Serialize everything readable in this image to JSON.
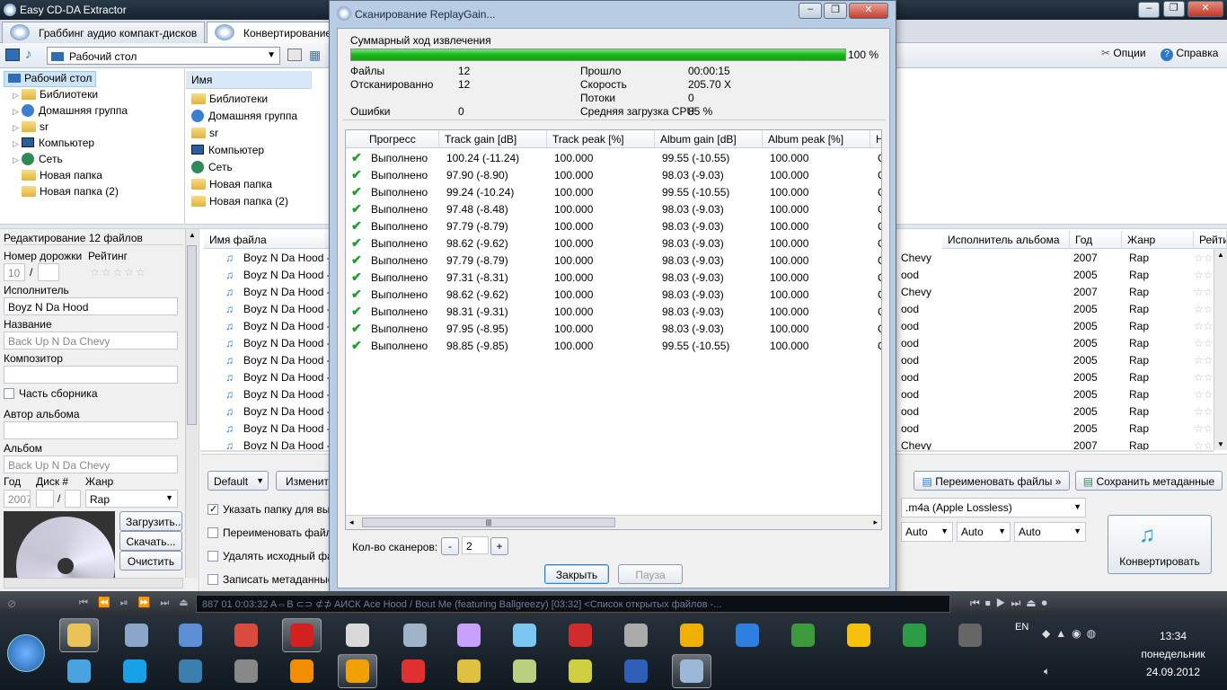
{
  "app": {
    "title": "Easy CD-DA Extractor",
    "tabs": [
      {
        "label": "Граббинг аудио компакт-дисков"
      },
      {
        "label": "Конвертирование"
      }
    ],
    "toolbar": {
      "location_combo": "Рабочий стол",
      "options_label": "Опции",
      "help_label": "Справка"
    }
  },
  "tree": {
    "root": "Рабочий стол",
    "items": [
      {
        "label": "Библиотеки"
      },
      {
        "label": "Домашняя группа"
      },
      {
        "label": "sr"
      },
      {
        "label": "Компьютер"
      },
      {
        "label": "Сеть"
      },
      {
        "label": "Новая папка"
      },
      {
        "label": "Новая папка (2)"
      }
    ]
  },
  "filelist": {
    "header": "Имя",
    "items": [
      {
        "label": "Библиотеки"
      },
      {
        "label": "Домашняя группа"
      },
      {
        "label": "sr"
      },
      {
        "label": "Компьютер"
      },
      {
        "label": "Сеть"
      },
      {
        "label": "Новая папка"
      },
      {
        "label": "Новая папка (2)"
      }
    ]
  },
  "editor": {
    "title": "Редактирование 12 файлов",
    "track_label": "Номер дорожки",
    "rating_label": "Рейтинг",
    "track_no": "10",
    "track_sep": "/",
    "artist_label": "Исполнитель",
    "artist": "Boyz N Da Hood",
    "title_label": "Название",
    "title_value": "Back Up N Da Chevy",
    "composer_label": "Композитор",
    "compilation_label": "Часть сборника",
    "album_artist_label": "Автор альбома",
    "album_label": "Альбом",
    "album_value": "Back Up N Da Chevy",
    "year_label": "Год",
    "disc_label": "Диск #",
    "genre_label": "Жанр",
    "year": "2007",
    "disc_sep": "/",
    "genre": "Rap",
    "load_btn": "Загрузить..",
    "download_btn": "Скачать...",
    "clear_btn": "Очистить"
  },
  "tracks": {
    "header_name": "Имя файла",
    "header_album_artist": "Исполнитель альбома",
    "header_year": "Год",
    "header_genre": "Жанр",
    "header_rating": "Рейти",
    "rows": [
      {
        "name": "Boyz N Da Hood -",
        "artist_tail": "Chevy",
        "year": "2007",
        "genre": "Rap"
      },
      {
        "name": "Boyz N Da Hood -",
        "artist_tail": "ood",
        "year": "2005",
        "genre": "Rap"
      },
      {
        "name": "Boyz N Da Hood -",
        "artist_tail": "Chevy",
        "year": "2007",
        "genre": "Rap"
      },
      {
        "name": "Boyz N Da Hood -",
        "artist_tail": "ood",
        "year": "2005",
        "genre": "Rap"
      },
      {
        "name": "Boyz N Da Hood -",
        "artist_tail": "ood",
        "year": "2005",
        "genre": "Rap"
      },
      {
        "name": "Boyz N Da Hood -",
        "artist_tail": "ood",
        "year": "2005",
        "genre": "Rap"
      },
      {
        "name": "Boyz N Da Hood -",
        "artist_tail": "ood",
        "year": "2005",
        "genre": "Rap"
      },
      {
        "name": "Boyz N Da Hood -",
        "artist_tail": "ood",
        "year": "2005",
        "genre": "Rap"
      },
      {
        "name": "Boyz N Da Hood -",
        "artist_tail": "ood",
        "year": "2005",
        "genre": "Rap"
      },
      {
        "name": "Boyz N Da Hood -",
        "artist_tail": "ood",
        "year": "2005",
        "genre": "Rap"
      },
      {
        "name": "Boyz N Da Hood -",
        "artist_tail": "ood",
        "year": "2005",
        "genre": "Rap"
      },
      {
        "name": "Boyz N Da Hood -",
        "artist_tail": "Chevy",
        "year": "2007",
        "genre": "Rap"
      }
    ]
  },
  "bottom": {
    "preset": "Default",
    "change_btn": "Изменит",
    "rename_files_btn": "Переименовать файлы »",
    "save_meta_btn": "Сохранить метаданные",
    "opt_folder": "Указать папку для вых",
    "opt_rename": "Переименовать файл",
    "opt_delete": "Удалять исходный фай",
    "opt_write": "Записать метаданные",
    "format": ".m4a (Apple Lossless)",
    "auto1": "Auto",
    "auto2": "Auto",
    "auto3": "Auto",
    "convert_btn": "Конвертировать"
  },
  "dialog": {
    "title": "Сканирование ReplayGain...",
    "summary_label": "Суммарный ход извлечения",
    "progress_pct": 100,
    "progress_text": "100 %",
    "files_label": "Файлы",
    "files": "12",
    "scanned_label": "Отсканированно",
    "scanned": "12",
    "errors_label": "Ошибки",
    "errors": "0",
    "elapsed_label": "Прошло",
    "elapsed": "00:00:15",
    "speed_label": "Скорость",
    "speed": "205.70 X",
    "threads_label": "Потоки",
    "threads": "0",
    "cpu_label": "Средняя загрузка CPU",
    "cpu": "85 %",
    "columns": [
      "Прогресс",
      "Track gain [dB]",
      "Track peak [%]",
      "Album gain [dB]",
      "Album peak [%]",
      "H"
    ],
    "rows": [
      {
        "status": "Выполнено",
        "tg": "100.24 (-11.24)",
        "tp": "100.000",
        "ag": "99.55 (-10.55)",
        "ap": "100.000",
        "h": "C"
      },
      {
        "status": "Выполнено",
        "tg": "97.90 (-8.90)",
        "tp": "100.000",
        "ag": "98.03 (-9.03)",
        "ap": "100.000",
        "h": "C"
      },
      {
        "status": "Выполнено",
        "tg": "99.24 (-10.24)",
        "tp": "100.000",
        "ag": "99.55 (-10.55)",
        "ap": "100.000",
        "h": "C"
      },
      {
        "status": "Выполнено",
        "tg": "97.48 (-8.48)",
        "tp": "100.000",
        "ag": "98.03 (-9.03)",
        "ap": "100.000",
        "h": "C"
      },
      {
        "status": "Выполнено",
        "tg": "97.79 (-8.79)",
        "tp": "100.000",
        "ag": "98.03 (-9.03)",
        "ap": "100.000",
        "h": "C"
      },
      {
        "status": "Выполнено",
        "tg": "98.62 (-9.62)",
        "tp": "100.000",
        "ag": "98.03 (-9.03)",
        "ap": "100.000",
        "h": "C"
      },
      {
        "status": "Выполнено",
        "tg": "97.79 (-8.79)",
        "tp": "100.000",
        "ag": "98.03 (-9.03)",
        "ap": "100.000",
        "h": "C"
      },
      {
        "status": "Выполнено",
        "tg": "97.31 (-8.31)",
        "tp": "100.000",
        "ag": "98.03 (-9.03)",
        "ap": "100.000",
        "h": "C"
      },
      {
        "status": "Выполнено",
        "tg": "98.62 (-9.62)",
        "tp": "100.000",
        "ag": "98.03 (-9.03)",
        "ap": "100.000",
        "h": "C"
      },
      {
        "status": "Выполнено",
        "tg": "98.31 (-9.31)",
        "tp": "100.000",
        "ag": "98.03 (-9.03)",
        "ap": "100.000",
        "h": "C"
      },
      {
        "status": "Выполнено",
        "tg": "97.95 (-8.95)",
        "tp": "100.000",
        "ag": "98.03 (-9.03)",
        "ap": "100.000",
        "h": "C"
      },
      {
        "status": "Выполнено",
        "tg": "98.85 (-9.85)",
        "tp": "100.000",
        "ag": "99.55 (-10.55)",
        "ap": "100.000",
        "h": "C"
      }
    ],
    "scanners_label": "Кол-во сканеров:",
    "scanners_minus": "-",
    "scanners_value": "2",
    "scanners_plus": "+",
    "close_btn": "Закрыть",
    "pause_btn": "Пауза"
  },
  "player": {
    "ticker": "887   01     0:03:32   A⇔B  ⊂⊃  ⊄⊅  AИСК   Ace Hood / Bout Me (featuring Ballgreezy)  [03:32]   <Список открытых файлов -..."
  },
  "taskbar": {
    "lang": "EN",
    "time": "13:34",
    "day": "понедельник",
    "date": "24.09.2012"
  },
  "colors": {
    "progress": "#16b616",
    "dialog_frame": "#b8cde3",
    "check": "#1d9e28"
  }
}
